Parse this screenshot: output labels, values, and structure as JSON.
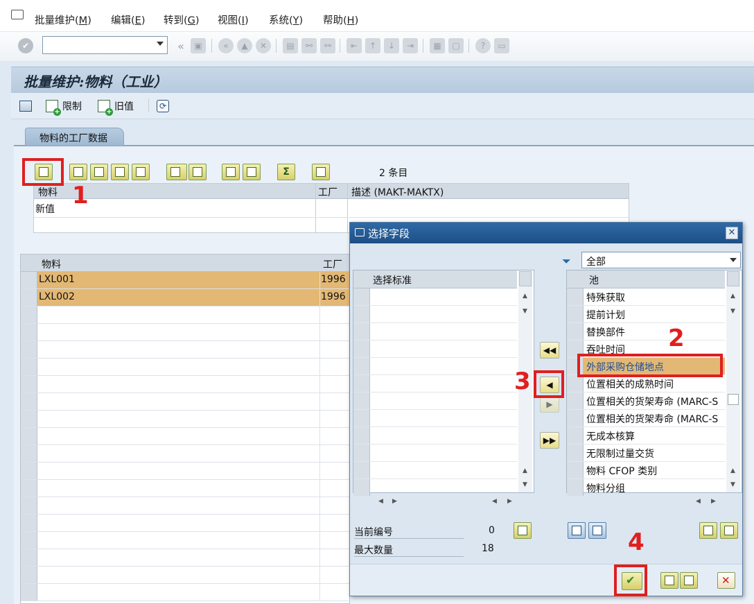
{
  "menu": {
    "items": [
      {
        "label": "批量维护(",
        "acc": "M",
        "tail": ")"
      },
      {
        "label": "编辑(",
        "acc": "E",
        "tail": ")"
      },
      {
        "label": "转到(",
        "acc": "G",
        "tail": ")"
      },
      {
        "label": "视图(",
        "acc": "I",
        "tail": ")"
      },
      {
        "label": "系统(",
        "acc": "Y",
        "tail": ")"
      },
      {
        "label": "帮助(",
        "acc": "H",
        "tail": ")"
      }
    ]
  },
  "command_field": {
    "value": ""
  },
  "page_title": "批量维护:物料（工业）",
  "app_toolbar": {
    "restrict_label": "限制",
    "old_value_label": "旧值"
  },
  "tab": {
    "label": "物料的工厂数据"
  },
  "entries_count": "2 条目",
  "top_table": {
    "headers": [
      "物料",
      "工厂",
      "描述 (MAKT-MAKTX)"
    ],
    "new_value_label": "新值"
  },
  "grid": {
    "headers": [
      "物料",
      "工厂"
    ],
    "rows": [
      {
        "material": "LXL001",
        "plant": "1996"
      },
      {
        "material": "LXL002",
        "plant": "1996"
      }
    ]
  },
  "dialog": {
    "title": "选择字段",
    "filter_value": "全部",
    "left_header": "选择标准",
    "right_header": "池",
    "pool_items": [
      "特殊获取",
      "提前计划",
      "替换部件",
      "吞吐时间",
      "外部采购仓储地点",
      "位置相关的成熟时间",
      "位置相关的货架寿命 (MARC-S",
      "位置相关的货架寿命 (MARC-S",
      "无成本核算",
      "无限制过量交货",
      "物料 CFOP 类别",
      "物料分组"
    ],
    "selected_index": 4,
    "current_number_label": "当前编号",
    "current_number_value": "0",
    "max_count_label": "最大数量",
    "max_count_value": "18"
  },
  "annotations": [
    "1",
    "2",
    "3",
    "4"
  ],
  "colors": {
    "selected_row": "#e3b874",
    "annotation": "#e01f1f",
    "title_bar": "#1d4f86"
  }
}
